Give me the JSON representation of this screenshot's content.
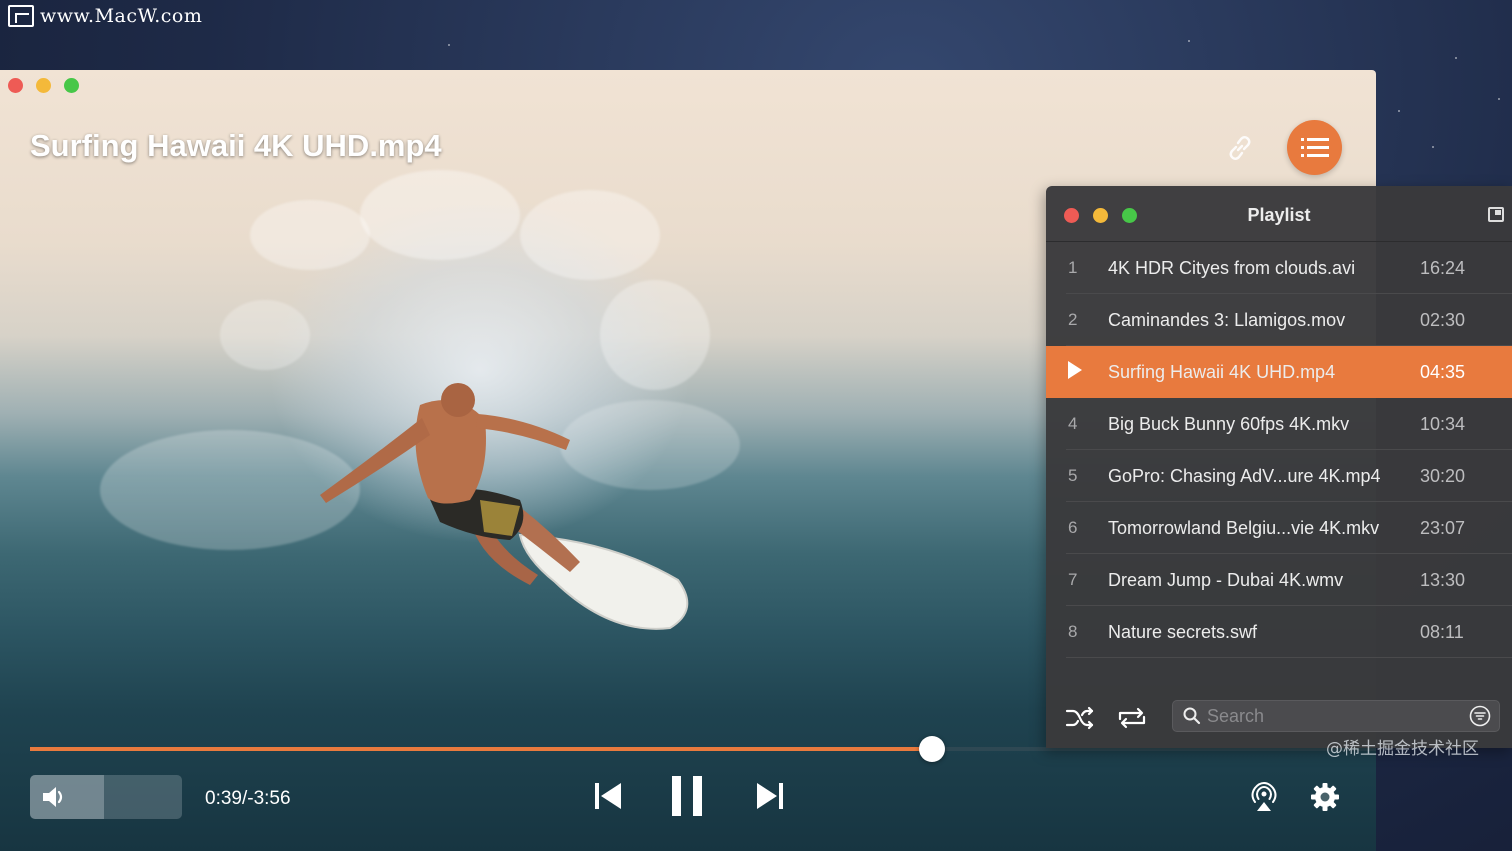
{
  "watermark": {
    "top": "www.MacW.com",
    "bottom": "@稀土掘金技术社区"
  },
  "player": {
    "title": "Surfing Hawaii 4K UHD.mp4",
    "time": "0:39/-3:56",
    "progress_fraction": 0.67,
    "volume_fraction": 0.49,
    "accent_color": "#e87a3e",
    "icons": {
      "link": "link-icon",
      "playlist_toggle": "list-icon",
      "volume": "speaker-icon",
      "prev": "skip-previous-icon",
      "pause": "pause-icon",
      "next": "skip-next-icon",
      "airplay": "airplay-icon",
      "settings": "gear-icon"
    }
  },
  "playlist": {
    "title": "Playlist",
    "active_index": 2,
    "items": [
      {
        "num": "1",
        "name": "4K HDR Cityes from clouds.avi",
        "duration": "16:24"
      },
      {
        "num": "2",
        "name": "Caminandes 3: Llamigos.mov",
        "duration": "02:30"
      },
      {
        "num": "",
        "name": "Surfing Hawaii 4K UHD.mp4",
        "duration": "04:35"
      },
      {
        "num": "4",
        "name": "Big Buck Bunny 60fps 4K.mkv",
        "duration": "10:34"
      },
      {
        "num": "5",
        "name": "GoPro: Chasing AdV...ure 4K.mp4",
        "duration": "30:20"
      },
      {
        "num": "6",
        "name": "Tomorrowland Belgiu...vie 4K.mkv",
        "duration": "23:07"
      },
      {
        "num": "7",
        "name": "Dream Jump - Dubai 4K.wmv",
        "duration": "13:30"
      },
      {
        "num": "8",
        "name": "Nature secrets.swf",
        "duration": "08:11"
      }
    ],
    "search": {
      "placeholder": "Search",
      "value": ""
    },
    "icons": {
      "shuffle": "shuffle-icon",
      "repeat": "repeat-icon",
      "filter": "filter-icon",
      "expand": "expand-icon"
    }
  }
}
